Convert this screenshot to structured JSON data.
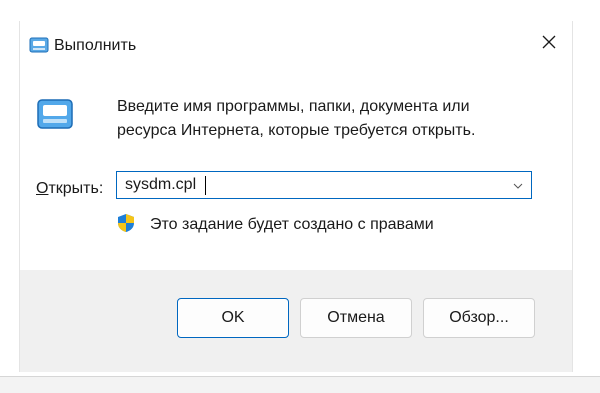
{
  "window": {
    "title": "Выполнить",
    "icon": "run-icon"
  },
  "dialog": {
    "description_line1": "Введите имя программы, папки, документа или",
    "description_line2": "ресурса Интернета, которые требуется открыть.",
    "open_label_access_key": "О",
    "open_label_rest": "ткрыть:",
    "open_value": "sysdm.cpl",
    "admin_notice": "Это задание будет создано с правами"
  },
  "buttons": {
    "ok": "OK",
    "cancel": "Отмена",
    "browse": "Обзор..."
  },
  "colors": {
    "accent": "#0067c0",
    "footer_bg": "#f0f0f0",
    "shield_blue": "#1e7fd8",
    "shield_yellow": "#f5c518"
  }
}
